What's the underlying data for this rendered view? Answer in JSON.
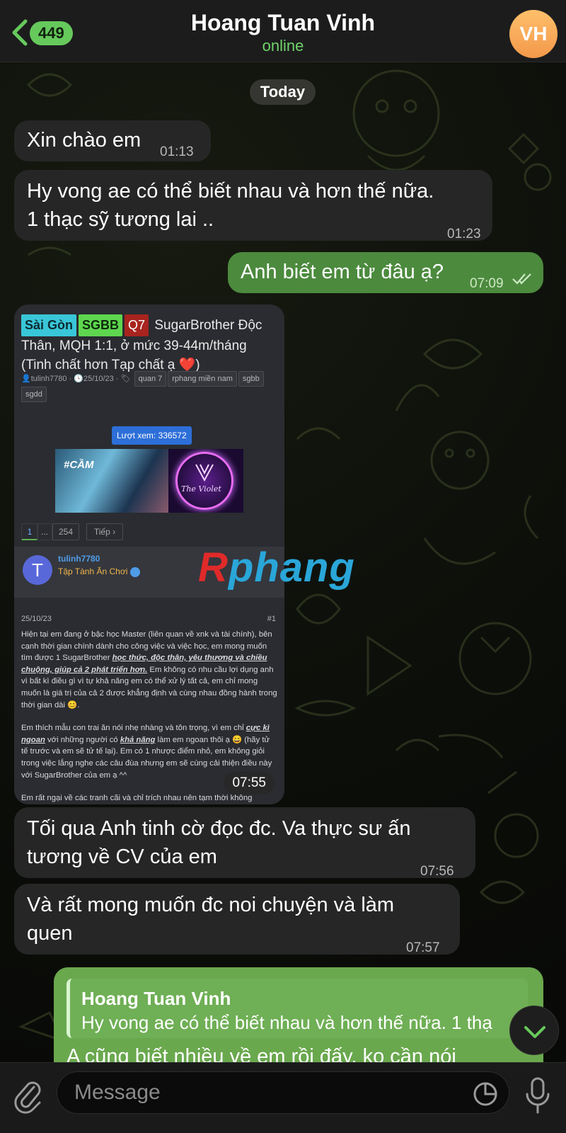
{
  "header": {
    "back_count": "449",
    "title": "Hoang Tuan Vinh",
    "status": "online",
    "avatar_initials": "VH"
  },
  "date_divider": "Today",
  "messages": [
    {
      "text": "Xin chào em",
      "time": "01:13"
    },
    {
      "text_line1": "Hy vong ae có thể biết nhau và hơn thế nữa.",
      "text_line2": "1 thạc sỹ tương lai ..",
      "time": "01:23"
    },
    {
      "text": "Anh biết em từ đâu ạ?",
      "time": "07:09"
    },
    {
      "time": "07:55"
    },
    {
      "text_line1": "Tối qua Anh tinh cờ đọc đc. Va thực sư ấn",
      "text_line2": "tương về CV của em",
      "time": "07:56"
    },
    {
      "text_line1": "Và rất mong muốn đc noi chuyện và làm",
      "text_line2": "quen",
      "time": "07:57"
    },
    {
      "reply_to_name": "Hoang Tuan Vinh",
      "reply_to_text": "Hy vong ae có thể biết nhau và hơn thế nữa. 1 thạ",
      "text": "A cũng biết nhiều về em rồi đấy. ko cần nói"
    }
  ],
  "screenshot": {
    "tags": [
      "Sài Gòn",
      "SGBB",
      "Q7"
    ],
    "title_line1": "SugarBrother Độc",
    "title_line2": "Thân, MQH 1:1, ở mức 39-44m/tháng",
    "title_line3": "(Tinh chất hơn Tạp chất ạ ❤️)",
    "author_meta": "tulinh7780 · ",
    "date_meta": "25/10/23 ·",
    "chips": [
      "quan 7",
      "rphang miền nam",
      "sgbb",
      "sgdd"
    ],
    "views": "Lượt xem: 336572",
    "banner_text_left": "#CẦM",
    "banner_text_right": "The Violet",
    "pager": [
      "1",
      "...",
      "254",
      "Tiếp ›"
    ],
    "username": "tulinh7780",
    "user_rank": "Tập Tành Ăn Chơi",
    "avatar_letter": "T",
    "post_date": "25/10/23",
    "post_num": "#1",
    "p1_a": "Hiện tại em đang ở bậc học Master (liên quan về xnk và tài chính), bên cạnh thời gian chính dành cho công việc và việc học, em mong muốn tìm được 1 SugarBrother ",
    "p1_em": "học thức, độc thân, yêu thương và chiều chuộng, giúp cả 2 phát triển hơn.",
    "p1_b": " Em không có nhu cầu lợi dụng anh vì bất kì điều gì vì tự khả năng em có thể xử lý tất cả, em chỉ mong muốn là giá trị của cả 2 được khẳng định và cùng nhau đồng hành trong thời gian dài 😊.",
    "p2_a": "Em thích mẫu con trai ăn nói nhẹ nhàng và tôn trọng, vì em chỉ ",
    "p2_em1": "cực kì ngoan",
    "p2_b": " với những người có ",
    "p2_em2": "khả năng",
    "p2_c": " làm em ngoan thôi ạ 😄 (hãy tử tế trước và em sẽ tử tế lại). Em có 1 nhược điểm nhỏ, em không giỏi trong việc lắng nghe các câu đùa nhưng em sẽ cùng cải thiện điều này với SugarBrother của em ạ ^^",
    "p3": "Em rất ngại về các tranh cãi và chỉ trích nhau nên tạm thời không"
  },
  "watermark": "Rphang",
  "composer": {
    "placeholder": "Message"
  },
  "colors": {
    "incoming_bubble": "#262626",
    "outgoing_bubble": "#4c8a3e",
    "accent_green": "#66c95c",
    "avatar_orange": "#f6a85a"
  }
}
